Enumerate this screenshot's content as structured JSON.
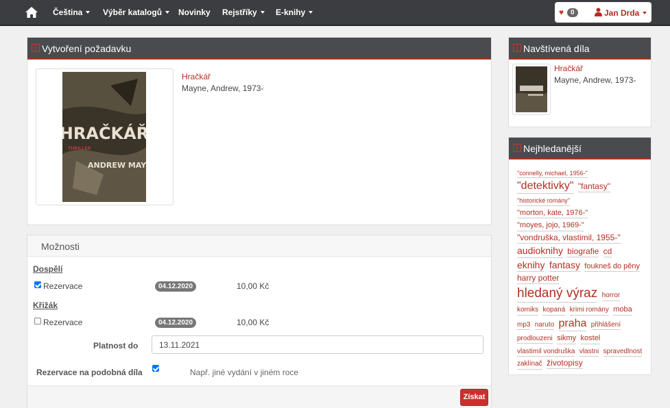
{
  "nav": {
    "items": [
      {
        "label": "Čeština",
        "dropdown": true
      },
      {
        "label": "Výběr katalogů",
        "dropdown": true
      },
      {
        "label": "Novinky",
        "dropdown": false
      },
      {
        "label": "Rejstříky",
        "dropdown": true
      },
      {
        "label": "E-knihy",
        "dropdown": true
      }
    ],
    "favorites_count": "0",
    "user_name": "Jan Drda"
  },
  "request": {
    "title": "Vytvoření požadavku",
    "book": {
      "title": "Hračkář",
      "author": "Mayne, Andrew, 1973-"
    },
    "cover": {
      "title_text": "HRAČKÁŘ",
      "author_text": "ANDREW MAYNE",
      "genre_text": "THRILLER"
    }
  },
  "options": {
    "title": "Možnosti",
    "groups": [
      {
        "label": "Dospělí",
        "option_label": "Rezervace",
        "checked": true,
        "date": "04.12.2020",
        "price": "10,00 Kč"
      },
      {
        "label": "Křižák",
        "option_label": "Rezervace",
        "checked": false,
        "date": "04.12.2020",
        "price": "10,00 Kč"
      }
    ],
    "validity_label": "Platnost do",
    "validity_value": "13.11.2021",
    "similar_label": "Rezervace na podobná díla",
    "similar_checked": true,
    "similar_hint": "Např. jiné vydání v jiném roce",
    "submit_label": "Získat"
  },
  "visited": {
    "title": "Navštívená díla",
    "items": [
      {
        "title": "Hračkář",
        "author": "Mayne, Andrew, 1973-"
      }
    ]
  },
  "popular": {
    "title": "Nejhledanější",
    "tags": [
      {
        "text": "\"connelly, michael, 1956-\"",
        "size": "t9"
      },
      {
        "text": "\"detektivky\"",
        "size": "t16"
      },
      {
        "text": "\"fantasy\"",
        "size": "t12"
      },
      {
        "text": "\"historické romány\"",
        "size": "t9"
      },
      {
        "text": "\"morton, kate, 1976-\"",
        "size": "t11"
      },
      {
        "text": "\"moyes, jojo, 1969-\"",
        "size": "t11"
      },
      {
        "text": "\"vondruška, vlastimil, 1955-\"",
        "size": "t12"
      },
      {
        "text": "audioknihy",
        "size": "t14"
      },
      {
        "text": "biografie",
        "size": "t12"
      },
      {
        "text": "cd",
        "size": "t12"
      },
      {
        "text": "eknihy",
        "size": "t14"
      },
      {
        "text": "fantasy",
        "size": "t14"
      },
      {
        "text": "foukneš do pěny",
        "size": "t11"
      },
      {
        "text": "harry potter",
        "size": "t12"
      },
      {
        "text": "hledaný výraz",
        "size": "t20"
      },
      {
        "text": "horror",
        "size": "t10"
      },
      {
        "text": "komiks",
        "size": "t10"
      },
      {
        "text": "kopaná",
        "size": "t10"
      },
      {
        "text": "krimi romány",
        "size": "t10"
      },
      {
        "text": "moba",
        "size": "t11"
      },
      {
        "text": "mp3",
        "size": "t10"
      },
      {
        "text": "naruto",
        "size": "t10"
      },
      {
        "text": "praha",
        "size": "t16"
      },
      {
        "text": "přihlášení",
        "size": "t10"
      },
      {
        "text": "prodlouzeni",
        "size": "t10"
      },
      {
        "text": "sikmy",
        "size": "t11"
      },
      {
        "text": "kostel",
        "size": "t11"
      },
      {
        "text": "vlastimil vondruška",
        "size": "t10"
      },
      {
        "text": "vlastni",
        "size": "t10"
      },
      {
        "text": "spravedlnost",
        "size": "t10"
      },
      {
        "text": "zaklínač",
        "size": "t10"
      },
      {
        "text": "životopisy",
        "size": "t12"
      }
    ]
  },
  "colors": {
    "accent": "#b32e22",
    "navbar": "#3c3d40",
    "panel_head": "#4a4b4e",
    "button": "#c9302c"
  }
}
